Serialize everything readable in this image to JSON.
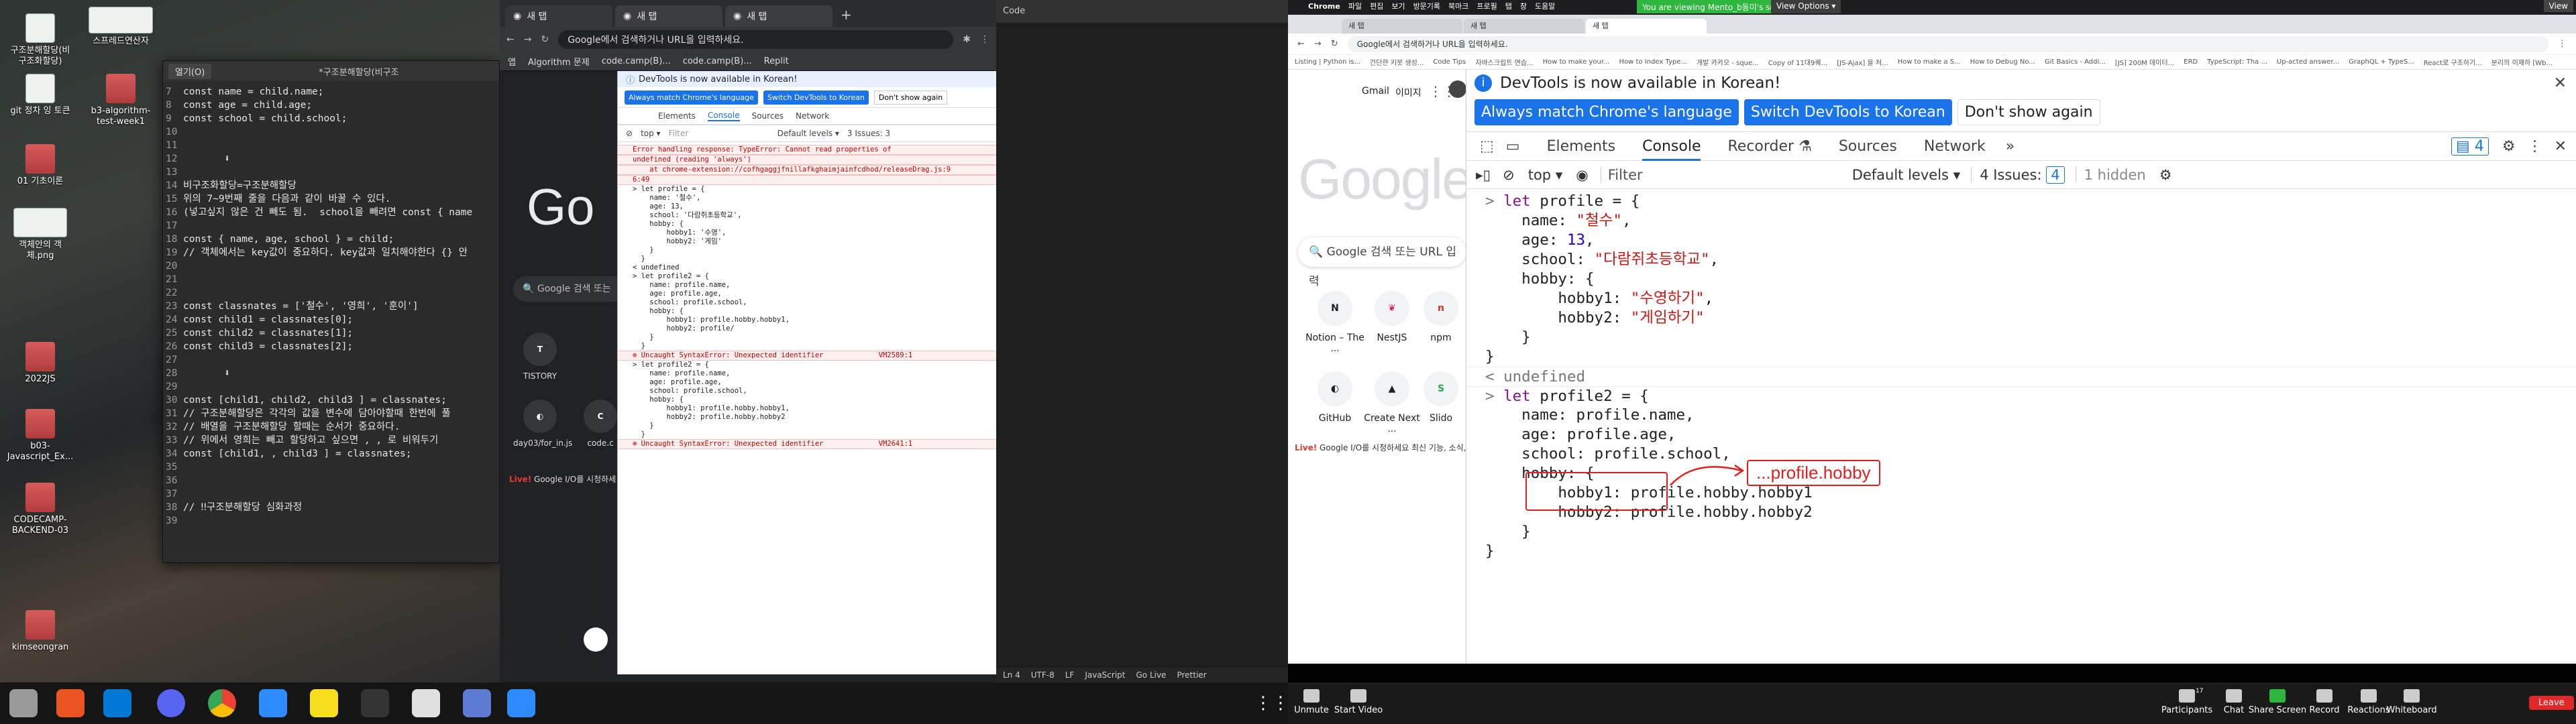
{
  "desktop": {
    "icons": [
      {
        "label": "구조분해할당(비\n구조화할당)"
      },
      {
        "label": "스프레드연산자"
      },
      {
        "label": "git 정차 잉 토큰"
      },
      {
        "label": "b3-algorithm-\ntest-week1"
      },
      {
        "label": "01 기초이론"
      },
      {
        "label": "객체안의 객\n체.png"
      },
      {
        "label": "2022JS"
      },
      {
        "label": "b03-\nJavascript_Ex..."
      },
      {
        "label": "CODECAMP-\nBACKEND-03"
      },
      {
        "label": "kimseongran"
      }
    ]
  },
  "editor": {
    "open_button": "열기(O)",
    "title": "*구조분해할당(비구조",
    "lines": [
      {
        "n": "7",
        "t": "const name = child.name;"
      },
      {
        "n": "8",
        "t": "const age = child.age;"
      },
      {
        "n": "9",
        "t": "const school = child.school;"
      },
      {
        "n": "10",
        "t": ""
      },
      {
        "n": "11",
        "t": ""
      },
      {
        "n": "12",
        "t": "       ⬇"
      },
      {
        "n": "13",
        "t": ""
      },
      {
        "n": "14",
        "t": "비구조화할당=구조분해할당"
      },
      {
        "n": "15",
        "t": "위의 7~9번째 줄을 다음과 같이 바꿀 수 있다."
      },
      {
        "n": "16",
        "t": "(넣고싶지 않은 건 빼도 됨.  school을 빼려면 const { name"
      },
      {
        "n": "17",
        "t": ""
      },
      {
        "n": "18",
        "t": "const { name, age, school } = child;"
      },
      {
        "n": "19",
        "t": "// 객체에서는 key값이 중요하다. key값과 일치해야한다 {} 안"
      },
      {
        "n": "20",
        "t": ""
      },
      {
        "n": "21",
        "t": ""
      },
      {
        "n": "22",
        "t": ""
      },
      {
        "n": "23",
        "t": "const classnates = ['철수', '영희', '훈이']"
      },
      {
        "n": "24",
        "t": "const child1 = classnates[0];"
      },
      {
        "n": "25",
        "t": "const child2 = classnates[1];"
      },
      {
        "n": "26",
        "t": "const child3 = classnates[2];"
      },
      {
        "n": "27",
        "t": ""
      },
      {
        "n": "28",
        "t": "       ⬇"
      },
      {
        "n": "29",
        "t": ""
      },
      {
        "n": "30",
        "t": "const [child1, child2, child3 ] = classnates;"
      },
      {
        "n": "31",
        "t": "// 구조분해할당은 각각의 값을 변수에 담아야할때 한번에 풀"
      },
      {
        "n": "32",
        "t": "// 배열을 구조분해할당 할때는 순서가 중요하다."
      },
      {
        "n": "33",
        "t": "// 위에서 영희는 빼고 할당하고 싶으면 , , 로 비워두기"
      },
      {
        "n": "34",
        "t": "const [child1, , child3 ] = classnates;"
      },
      {
        "n": "35",
        "t": ""
      },
      {
        "n": "36",
        "t": ""
      },
      {
        "n": "37",
        "t": ""
      },
      {
        "n": "38",
        "t": "// ‼구조분해할당 심화과정"
      },
      {
        "n": "39",
        "t": ""
      }
    ]
  },
  "chrome_small": {
    "tabs": [
      "새 탭",
      "새 탭",
      "새 탭"
    ],
    "omnibox": "Google에서 검색하거나 URL을 입력하세요.",
    "bookmarks": [
      "앱",
      "Algorithm 문제",
      "code.camp(B)...",
      "code.camp(B)...",
      "Replit"
    ],
    "search_placeholder": "Google 검색 또는",
    "shortcuts": [
      "TISTORY",
      "day03/for_in.js",
      "code.c"
    ],
    "io_banner": "Google I/O를 시청하세",
    "devtools": {
      "notice": "DevTools is now available in Korean!",
      "btn_match": "Always match Chrome's language",
      "btn_switch": "Switch DevTools to Korean",
      "btn_dont": "Don't show again",
      "tabs": [
        "Elements",
        "Console",
        "Sources",
        "Network"
      ],
      "filter": "Filter",
      "levels": "Default levels ▾",
      "issues": "3 Issues: 3",
      "lines": [
        {
          "t": "Error handling response: TypeError: Cannot read properties of",
          "e": true
        },
        {
          "t": "undefined (reading 'always')",
          "e": true
        },
        {
          "t": "    at chrome-extension://cofhgaggjfnillafkghaimjainfcdhod/releaseDrag.js:9",
          "e": true
        },
        {
          "t": "6:49",
          "e": true
        },
        {
          "t": "> let profile = {",
          "e": false
        },
        {
          "t": "    name: '철수',",
          "e": false
        },
        {
          "t": "    age: 13,",
          "e": false
        },
        {
          "t": "    school: '다람쥐초등학교',",
          "e": false
        },
        {
          "t": "    hobby: {",
          "e": false
        },
        {
          "t": "        hobby1: '수영',",
          "e": false
        },
        {
          "t": "        hobby2: '게임'",
          "e": false
        },
        {
          "t": "    }",
          "e": false
        },
        {
          "t": "  }",
          "e": false
        },
        {
          "t": "< undefined",
          "e": false
        },
        {
          "t": "> let profile2 = {",
          "e": false
        },
        {
          "t": "    name: profile.name,",
          "e": false
        },
        {
          "t": "    age: profile.age,",
          "e": false
        },
        {
          "t": "    school: profile.school,",
          "e": false
        },
        {
          "t": "    hobby: {",
          "e": false
        },
        {
          "t": "        hobby1: profile.hobby.hobby1,",
          "e": false
        },
        {
          "t": "        hobby2: profile/",
          "e": false
        },
        {
          "t": "    }",
          "e": false
        },
        {
          "t": "  }",
          "e": false
        },
        {
          "t": "⊗ Uncaught SyntaxError: Unexpected identifier             VM2589:1",
          "e": true
        },
        {
          "t": "> let profile2 = {",
          "e": false
        },
        {
          "t": "    name: profile.name,",
          "e": false
        },
        {
          "t": "    age: profile.age,",
          "e": false
        },
        {
          "t": "    school: profile.school,",
          "e": false
        },
        {
          "t": "    hobby: {",
          "e": false
        },
        {
          "t": "        hobby1: profile.hobby.hobby1,",
          "e": false
        },
        {
          "t": "        hobby2: profile.hobby.hobby2",
          "e": false
        },
        {
          "t": "    }",
          "e": false
        },
        {
          "t": "  }",
          "e": false
        },
        {
          "t": "⊗ Uncaught SyntaxError: Unexpected identifier             VM2641:1",
          "e": true
        }
      ]
    }
  },
  "vscode": {
    "title": "Code",
    "status": [
      "Ln 4",
      "UTF-8",
      "LF",
      "JavaScript",
      "Go Live",
      "Prettier"
    ]
  },
  "zoom": {
    "menu": [
      "Chrome",
      "파일",
      "편집",
      "보기",
      "방문기록",
      "북마크",
      "프로필",
      "탭",
      "창",
      "도움말"
    ],
    "share_notice": "You are viewing Mento_b동미's screen",
    "view_options": "View Options ▾",
    "view_btn": "View",
    "bottom": [
      "Unmute",
      "Start Video",
      "Participants",
      "Chat",
      "Share Screen",
      "Record",
      "Reactions",
      "Whiteboard"
    ],
    "participants_count": "17",
    "leave": "Leave"
  },
  "chrome_big": {
    "tabs": [
      "새 탭",
      "새 탭",
      "새 탭"
    ],
    "omnibox": "Google에서 검색하거나 URL을 입력하세요.",
    "bookmarks": [
      "Listing | Python is...",
      "간단한 키봇 생성...",
      "Code Tips",
      "자바스크립트 연습...",
      "How to make your...",
      "How to Index Type...",
      "개발 카카오 - sque...",
      "Copy of 11대9퀘...",
      "[JS-Ajax] 을 처...",
      "How to make a S...",
      "How to Debug No...",
      "Git Basics - Addi...",
      "[JS] 200M 데이터...",
      "ERD",
      "TypeScript: Tha ...",
      "Up-acted answer...",
      "GraphQL + TypeS...",
      "React로 구조하기...",
      "분리의 이재하 [Wb..."
    ],
    "gmail": "Gmail",
    "images": "이미지",
    "search_placeholder": "Google 검색 또는 URL 입력",
    "shortcuts": [
      "Notion – The ...",
      "NestJS",
      "npm",
      "GitHub",
      "Create Next ...",
      "Slido"
    ],
    "io_banner": "Google I/O를 시청하세요",
    "io_tail": "최신 기능, 소식, 출시 계획을 소...",
    "devtools": {
      "notice": "DevTools is now available in Korean!",
      "btn_match": "Always match Chrome's language",
      "btn_switch": "Switch DevTools to Korean",
      "btn_dont": "Don't show again",
      "tabs": [
        "Elements",
        "Console",
        "Recorder",
        "Sources",
        "Network"
      ],
      "issues_badge": "4",
      "context": "top ▾",
      "filter": "Filter",
      "levels": "Default levels ▾",
      "issues": "4 Issues:",
      "issues_n": "4",
      "hidden": "1 hidden",
      "undefined": "undefined",
      "annotation": "...profile.hobby"
    }
  }
}
